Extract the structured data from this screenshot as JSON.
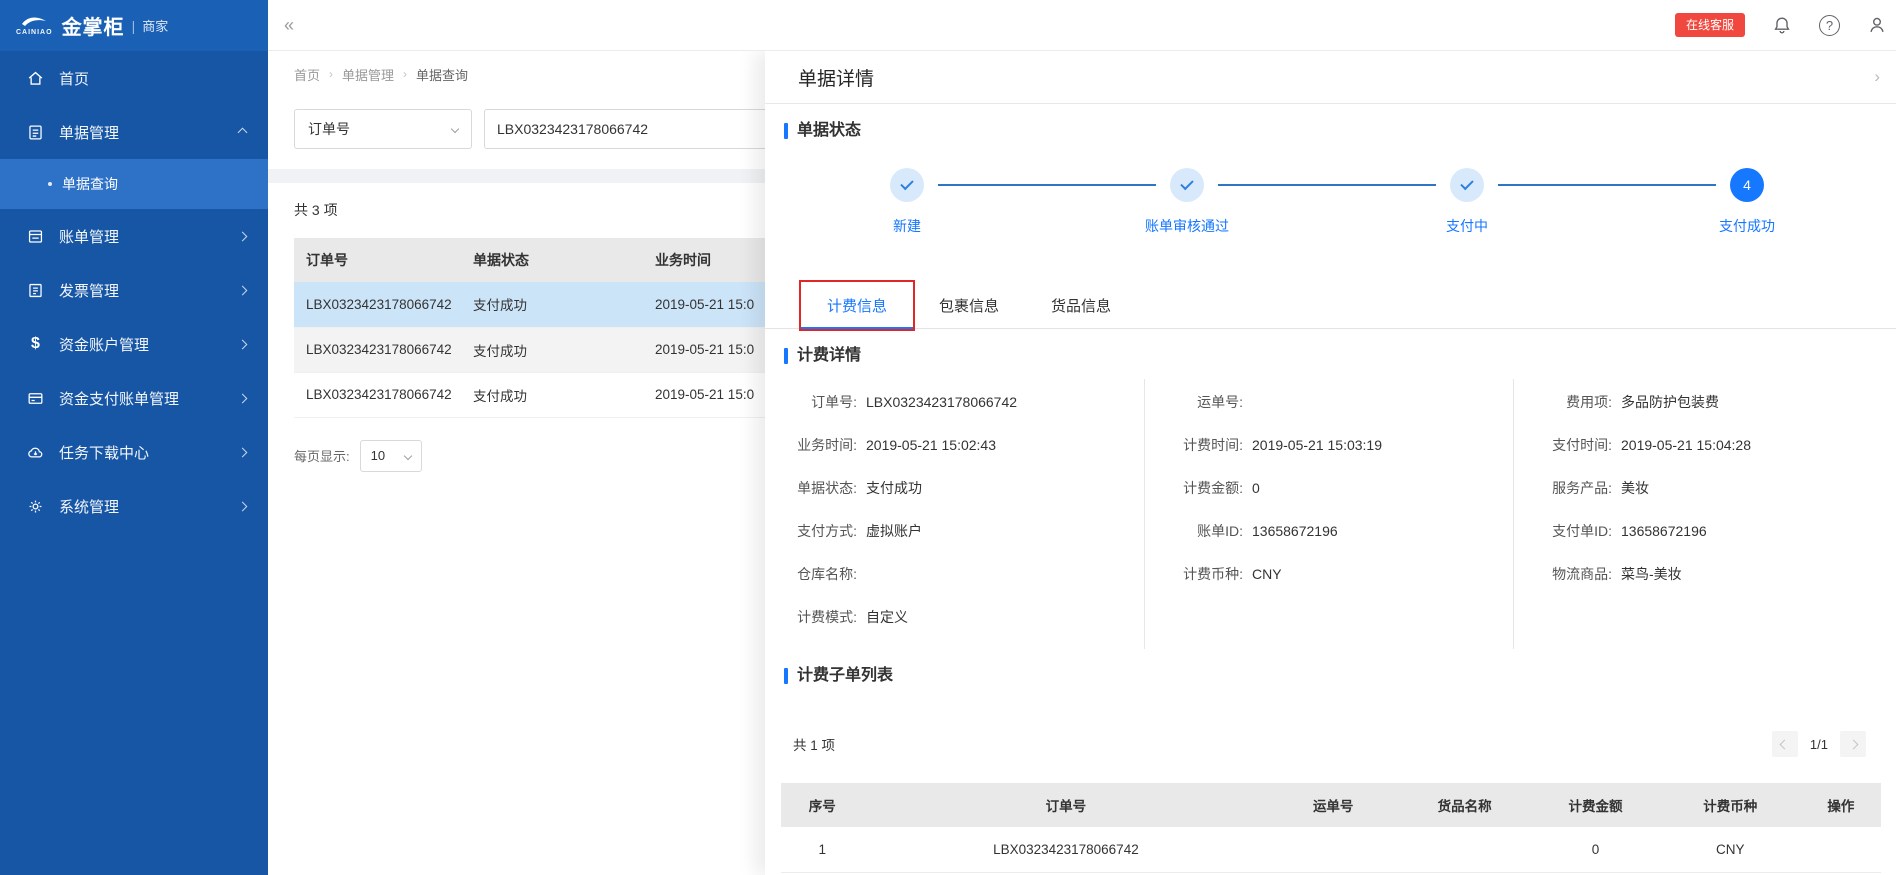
{
  "brand": {
    "logo_text": "CAINIAO",
    "product": "金掌柜",
    "divider": "|",
    "audience": "商家"
  },
  "topbar": {
    "collapse": "«",
    "service_badge": "在线客服"
  },
  "sidebar": {
    "items": [
      {
        "label": "首页"
      },
      {
        "label": "单据管理"
      },
      {
        "label": "账单管理"
      },
      {
        "label": "发票管理"
      },
      {
        "label": "资金账户管理"
      },
      {
        "label": "资金支付账单管理"
      },
      {
        "label": "任务下载中心"
      },
      {
        "label": "系统管理"
      }
    ],
    "submenu": {
      "label": "单据查询"
    }
  },
  "breadcrumb": {
    "items": [
      "首页",
      "单据管理",
      "单据查询"
    ],
    "separator": "›"
  },
  "filter": {
    "type_select": "订单号",
    "keyword": "LBX0323423178066742"
  },
  "list": {
    "total": "共 3 项",
    "columns": [
      "订单号",
      "单据状态",
      "业务时间"
    ],
    "rows": [
      {
        "order_no": "LBX0323423178066742",
        "status": "支付成功",
        "biz_time": "2019-05-21 15:0"
      },
      {
        "order_no": "LBX0323423178066742",
        "status": "支付成功",
        "biz_time": "2019-05-21 15:0"
      },
      {
        "order_no": "LBX0323423178066742",
        "status": "支付成功",
        "biz_time": "2019-05-21 15:0"
      }
    ],
    "page_size_label": "每页显示:",
    "page_size": "10"
  },
  "drawer": {
    "title": "单据详情",
    "collapse": "›",
    "sections": {
      "status": "单据状态",
      "detail": "计费详情",
      "sublist": "计费子单列表"
    },
    "steps": [
      {
        "label": "新建"
      },
      {
        "label": "账单审核通过"
      },
      {
        "label": "支付中"
      },
      {
        "label": "支付成功",
        "number": "4"
      }
    ],
    "tabs": [
      "计费信息",
      "包裹信息",
      "货品信息"
    ],
    "detail": {
      "col1": [
        {
          "label": "订单号",
          "value": "LBX0323423178066742"
        },
        {
          "label": "业务时间",
          "value": "2019-05-21 15:02:43"
        },
        {
          "label": "单据状态",
          "value": "支付成功"
        },
        {
          "label": "支付方式",
          "value": "虚拟账户"
        },
        {
          "label": "仓库名称",
          "value": ""
        },
        {
          "label": "计费模式",
          "value": "自定义"
        }
      ],
      "col2": [
        {
          "label": "运单号",
          "value": ""
        },
        {
          "label": "计费时间",
          "value": "2019-05-21 15:03:19"
        },
        {
          "label": "计费金额",
          "value": "0"
        },
        {
          "label": "账单ID",
          "value": "13658672196"
        },
        {
          "label": "计费币种",
          "value": "CNY"
        }
      ],
      "col3": [
        {
          "label": "费用项",
          "value": "多品防护包装费"
        },
        {
          "label": "支付时间",
          "value": "2019-05-21 15:04:28"
        },
        {
          "label": "服务产品",
          "value": "美妆"
        },
        {
          "label": "支付单ID",
          "value": "13658672196"
        },
        {
          "label": "物流商品",
          "value": "菜鸟-美妆"
        }
      ]
    },
    "sublist": {
      "total": "共 1 项",
      "page": "1/1",
      "columns": [
        "序号",
        "订单号",
        "运单号",
        "货品名称",
        "计费金额",
        "计费币种",
        "操作"
      ],
      "rows": [
        {
          "seq": "1",
          "order_no": "LBX0323423178066742",
          "waybill": "",
          "goods": "",
          "amount": "0",
          "currency": "CNY",
          "action": ""
        }
      ]
    }
  }
}
